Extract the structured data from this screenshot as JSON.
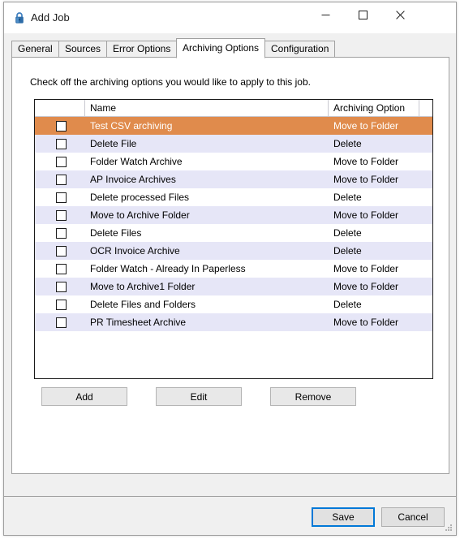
{
  "window": {
    "title": "Add Job",
    "icon": "lock-icon",
    "controls": {
      "minimize": "minimize-icon",
      "maximize": "maximize-icon",
      "close": "close-icon"
    }
  },
  "tabs": [
    {
      "label": "General",
      "selected": false
    },
    {
      "label": "Sources",
      "selected": false
    },
    {
      "label": "Error Options",
      "selected": false
    },
    {
      "label": "Archiving Options",
      "selected": true
    },
    {
      "label": "Configuration",
      "selected": false
    }
  ],
  "page": {
    "instruction": "Check off the archiving options you would like to apply to this job."
  },
  "grid": {
    "columns": [
      "",
      "Name",
      "Archiving Option",
      ""
    ],
    "rows": [
      {
        "checked": false,
        "name": "Test CSV archiving",
        "option": "Move to Folder",
        "selected": true
      },
      {
        "checked": false,
        "name": "Delete File",
        "option": "Delete",
        "selected": false
      },
      {
        "checked": false,
        "name": "Folder Watch Archive",
        "option": "Move to Folder",
        "selected": false
      },
      {
        "checked": false,
        "name": "AP Invoice Archives",
        "option": "Move to Folder",
        "selected": false
      },
      {
        "checked": false,
        "name": "Delete processed Files",
        "option": "Delete",
        "selected": false
      },
      {
        "checked": false,
        "name": "Move to Archive Folder",
        "option": "Move to Folder",
        "selected": false
      },
      {
        "checked": false,
        "name": "Delete Files",
        "option": "Delete",
        "selected": false
      },
      {
        "checked": false,
        "name": "OCR Invoice Archive",
        "option": "Delete",
        "selected": false
      },
      {
        "checked": false,
        "name": "Folder Watch - Already In Paperless",
        "option": "Move to Folder",
        "selected": false
      },
      {
        "checked": false,
        "name": "Move to Archive1 Folder",
        "option": "Move to Folder",
        "selected": false
      },
      {
        "checked": false,
        "name": "Delete Files and Folders",
        "option": "Delete",
        "selected": false
      },
      {
        "checked": false,
        "name": "PR Timesheet Archive",
        "option": "Move to Folder",
        "selected": false
      }
    ]
  },
  "actions": {
    "add": "Add",
    "edit": "Edit",
    "remove": "Remove"
  },
  "footer": {
    "save": "Save",
    "cancel": "Cancel"
  },
  "colors": {
    "selected_row": "#e08b4c",
    "alt_row": "#e6e6f7",
    "focus_border": "#0078d7",
    "dialog_bg": "#f0f0f0",
    "lock_icon": "#2d6ca8"
  }
}
